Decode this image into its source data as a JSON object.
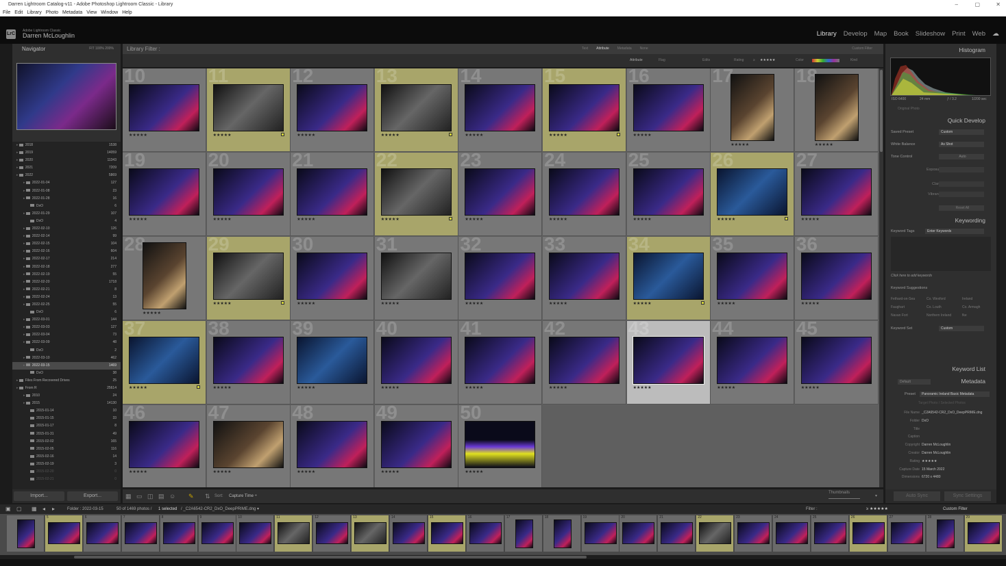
{
  "window": {
    "title": "Darren Lightroom Catalog-v11 - Adobe Photoshop Lightroom Classic - Library",
    "minimize": "–",
    "maximize": "▢",
    "close": "✕"
  },
  "menu": [
    "File",
    "Edit",
    "Library",
    "Photo",
    "Metadata",
    "View",
    "Window",
    "Help"
  ],
  "identity": {
    "badge": "LrC",
    "app": "Adobe Lightroom Classic",
    "user": "Darren McLoughlin"
  },
  "modules": [
    "Library",
    "Develop",
    "Map",
    "Book",
    "Slideshow",
    "Print",
    "Web"
  ],
  "active_module": "Library",
  "navigator": {
    "title": "Navigator",
    "zoom": "FIT   100%   200%"
  },
  "folders": [
    {
      "name": "2018",
      "count": "1538",
      "indent": 0
    },
    {
      "name": "2019",
      "count": "14059",
      "indent": 0
    },
    {
      "name": "2020",
      "count": "11343",
      "indent": 0
    },
    {
      "name": "2021",
      "count": "7209",
      "indent": 0
    },
    {
      "name": "2022",
      "count": "5869",
      "indent": 0
    },
    {
      "name": "2022-01-04",
      "count": "127",
      "indent": 1
    },
    {
      "name": "2022-01-08",
      "count": "23",
      "indent": 1
    },
    {
      "name": "2022-01-28",
      "count": "16",
      "indent": 1
    },
    {
      "name": "DxO",
      "count": "6",
      "indent": 2
    },
    {
      "name": "2022-01-29",
      "count": "107",
      "indent": 1
    },
    {
      "name": "DxO",
      "count": "4",
      "indent": 2
    },
    {
      "name": "2022-02-10",
      "count": "126",
      "indent": 1
    },
    {
      "name": "2022-02-14",
      "count": "99",
      "indent": 1
    },
    {
      "name": "2022-02-15",
      "count": "104",
      "indent": 1
    },
    {
      "name": "2022-02-16",
      "count": "604",
      "indent": 1
    },
    {
      "name": "2022-02-17",
      "count": "214",
      "indent": 1
    },
    {
      "name": "2022-02-18",
      "count": "277",
      "indent": 1
    },
    {
      "name": "2022-02-19",
      "count": "55",
      "indent": 1
    },
    {
      "name": "2022-02-20",
      "count": "1718",
      "indent": 1
    },
    {
      "name": "2022-02-21",
      "count": "8",
      "indent": 1
    },
    {
      "name": "2022-02-24",
      "count": "13",
      "indent": 1
    },
    {
      "name": "2022-02-25",
      "count": "55",
      "indent": 1
    },
    {
      "name": "DxO",
      "count": "6",
      "indent": 2
    },
    {
      "name": "2022-03-01",
      "count": "144",
      "indent": 1
    },
    {
      "name": "2022-03-03",
      "count": "127",
      "indent": 1
    },
    {
      "name": "2022-03-04",
      "count": "73",
      "indent": 1
    },
    {
      "name": "2022-03-09",
      "count": "48",
      "indent": 1
    },
    {
      "name": "DxO",
      "count": "2",
      "indent": 2
    },
    {
      "name": "2022-03-10",
      "count": "462",
      "indent": 1
    },
    {
      "name": "2022-03-15",
      "count": "1469",
      "indent": 1,
      "selected": true
    },
    {
      "name": "DxO",
      "count": "38",
      "indent": 2
    },
    {
      "name": "Files From Recovered Drives",
      "count": "25",
      "indent": 0
    },
    {
      "name": "From R",
      "count": "25614",
      "indent": 0
    },
    {
      "name": "2010",
      "count": "24",
      "indent": 1
    },
    {
      "name": "2015",
      "count": "14130",
      "indent": 1
    },
    {
      "name": "2015-01-14",
      "count": "10",
      "indent": 2
    },
    {
      "name": "2015-01-15",
      "count": "33",
      "indent": 2
    },
    {
      "name": "2015-01-17",
      "count": "8",
      "indent": 2
    },
    {
      "name": "2015-01-31",
      "count": "49",
      "indent": 2
    },
    {
      "name": "2015-02-02",
      "count": "165",
      "indent": 2
    },
    {
      "name": "2015-02-05",
      "count": "116",
      "indent": 2
    },
    {
      "name": "2015-02-16",
      "count": "14",
      "indent": 2
    },
    {
      "name": "2015-02-19",
      "count": "3",
      "indent": 2
    },
    {
      "name": "2015-02-20",
      "count": "0",
      "indent": 2,
      "dim": true
    },
    {
      "name": "2015-02-21",
      "count": "0",
      "indent": 2,
      "dim": true
    }
  ],
  "buttons": {
    "import": "Import...",
    "export": "Export..."
  },
  "library_filter": {
    "title": "Library Filter :",
    "tabs": [
      "Text",
      "Attribute",
      "Metadata",
      "None"
    ],
    "active": "Attribute",
    "custom": "Custom Filter"
  },
  "attribute_bar": {
    "attribute": "Attribute",
    "flag": "Flag",
    "edits": "Edits",
    "rating": "Rating",
    "rating_op": "≥",
    "stars": "★★★★★",
    "color": "Color",
    "kind": "Kind"
  },
  "grid_rows": [
    [
      {
        "n": "10",
        "o": "l",
        "t": ""
      },
      {
        "n": "11",
        "o": "l",
        "t": "bw",
        "pick": true
      },
      {
        "n": "12",
        "o": "l",
        "t": ""
      },
      {
        "n": "13",
        "o": "l",
        "t": "bw",
        "pick": true
      },
      {
        "n": "14",
        "o": "l",
        "t": ""
      },
      {
        "n": "15",
        "o": "l",
        "t": "",
        "pick": true
      },
      {
        "n": "16",
        "o": "l",
        "t": ""
      },
      {
        "n": "17",
        "o": "p",
        "t": "w"
      },
      {
        "n": "18",
        "o": "p",
        "t": "w"
      }
    ],
    [
      {
        "n": "19",
        "o": "l",
        "t": ""
      },
      {
        "n": "20",
        "o": "l",
        "t": ""
      },
      {
        "n": "21",
        "o": "l",
        "t": ""
      },
      {
        "n": "22",
        "o": "l",
        "t": "bw",
        "pick": true
      },
      {
        "n": "23",
        "o": "l",
        "t": ""
      },
      {
        "n": "24",
        "o": "l",
        "t": ""
      },
      {
        "n": "25",
        "o": "l",
        "t": ""
      },
      {
        "n": "26",
        "o": "l",
        "t": "bl",
        "pick": true
      },
      {
        "n": "27",
        "o": "l",
        "t": ""
      }
    ],
    [
      {
        "n": "28",
        "o": "p",
        "t": "w"
      },
      {
        "n": "29",
        "o": "l",
        "t": "bw",
        "pick": true
      },
      {
        "n": "30",
        "o": "l",
        "t": ""
      },
      {
        "n": "31",
        "o": "l",
        "t": "bw"
      },
      {
        "n": "32",
        "o": "l",
        "t": ""
      },
      {
        "n": "33",
        "o": "l",
        "t": ""
      },
      {
        "n": "34",
        "o": "l",
        "t": "bl",
        "pick": true
      },
      {
        "n": "35",
        "o": "l",
        "t": ""
      },
      {
        "n": "36",
        "o": "l",
        "t": ""
      }
    ],
    [
      {
        "n": "37",
        "o": "l",
        "t": "bl",
        "pick": true
      },
      {
        "n": "38",
        "o": "l",
        "t": ""
      },
      {
        "n": "39",
        "o": "l",
        "t": "bl"
      },
      {
        "n": "40",
        "o": "l",
        "t": ""
      },
      {
        "n": "41",
        "o": "l",
        "t": ""
      },
      {
        "n": "42",
        "o": "l",
        "t": ""
      },
      {
        "n": "43",
        "o": "l",
        "t": "",
        "cur": true
      },
      {
        "n": "44",
        "o": "l",
        "t": ""
      },
      {
        "n": "45",
        "o": "l",
        "t": ""
      }
    ],
    [
      {
        "n": "46",
        "o": "l",
        "t": ""
      },
      {
        "n": "47",
        "o": "l",
        "t": "w"
      },
      {
        "n": "48",
        "o": "l",
        "t": ""
      },
      {
        "n": "49",
        "o": "l",
        "t": ""
      },
      {
        "n": "50",
        "o": "l",
        "t": "g"
      }
    ]
  ],
  "stars": "★★★★★",
  "toolbar": {
    "sort_label": "Sort:",
    "sort_value": "Capture Time ÷",
    "thumbnails": "Thumbnails"
  },
  "histogram": {
    "title": "Histogram",
    "iso": "ISO 6400",
    "focal": "24 mm",
    "aperture": "ƒ / 3.2",
    "shutter": "1/200 sec",
    "original": "Original Photo"
  },
  "quick_develop": {
    "title": "Quick Develop",
    "saved_preset_label": "Saved Preset",
    "saved_preset": "Custom",
    "wb_label": "White Balance",
    "wb": "As Shot",
    "tone_label": "Tone Control",
    "auto": "Auto",
    "exposure": "Exposure",
    "clarity": "Clarity",
    "vibrance": "Vibrance",
    "reset": "Reset All"
  },
  "keywording": {
    "title": "Keywording",
    "tags_label": "Keyword Tags",
    "tags_value": "Enter Keywords",
    "hint": "Click here to add keywords",
    "suggestions_label": "Keyword Suggestions",
    "suggestions": [
      "Fethard-on-Sea",
      "Co. Wexford",
      "Ireland",
      "Faughart",
      "Co. Louth",
      "Co. Armagh",
      "Navan Fort",
      "Northern Ireland",
      "fke"
    ],
    "set_label": "Keyword Set",
    "set_value": "Custom"
  },
  "keyword_list": {
    "title": "Keyword List"
  },
  "metadata": {
    "title": "Metadata",
    "default": "Default",
    "preset_label": "Preset",
    "preset": "Panoramic Ireland Basic Metadata",
    "target": "Target Photo / Selected Photos",
    "fields": [
      {
        "label": "File Name",
        "value": "_C2A6542-CR2_DxO_DeepPRIME.dng"
      },
      {
        "label": "Folder",
        "value": "DxO"
      },
      {
        "label": "Title",
        "value": ""
      },
      {
        "label": "Caption",
        "value": ""
      },
      {
        "label": "Copyright",
        "value": "Darren McLoughlin"
      },
      {
        "label": "Creator",
        "value": "Darren McLoughlin"
      },
      {
        "label": "Rating",
        "value": "★★★★★"
      },
      {
        "label": "Capture Date",
        "value": "15 March 2022"
      },
      {
        "label": "Dimensions",
        "value": "6720 x 4480"
      }
    ]
  },
  "sync": {
    "auto": "Auto Sync",
    "settings": "Sync Settings"
  },
  "filmstrip_bar": {
    "folder": "Folder : 2022-03-15",
    "count": "50 of 1469 photos /",
    "selected": "1 selected",
    "file": "/ _C2A6542-CR2_DxO_DeepPRIME.dng ▾",
    "filter_label": "Filter :",
    "filter_stars": "≥ ★★★★★",
    "filter_value": "Custom Filter"
  },
  "filmstrip": [
    {
      "n": "",
      "p": true,
      "pick": false
    },
    {
      "n": "5",
      "p": false,
      "pick": true
    },
    {
      "n": "6",
      "p": false,
      "pick": false
    },
    {
      "n": "7",
      "p": false,
      "pick": false
    },
    {
      "n": "8",
      "p": false,
      "pick": false
    },
    {
      "n": "9",
      "p": false,
      "pick": false
    },
    {
      "n": "10",
      "p": false,
      "pick": false
    },
    {
      "n": "11",
      "p": false,
      "pick": true,
      "bw": true
    },
    {
      "n": "12",
      "p": false,
      "pick": false
    },
    {
      "n": "13",
      "p": false,
      "pick": true,
      "bw": true
    },
    {
      "n": "14",
      "p": false,
      "pick": false
    },
    {
      "n": "15",
      "p": false,
      "pick": true
    },
    {
      "n": "16",
      "p": false,
      "pick": false
    },
    {
      "n": "17",
      "p": true,
      "pick": false
    },
    {
      "n": "18",
      "p": true,
      "pick": false
    },
    {
      "n": "19",
      "p": false,
      "pick": false
    },
    {
      "n": "20",
      "p": false,
      "pick": false
    },
    {
      "n": "21",
      "p": false,
      "pick": false
    },
    {
      "n": "22",
      "p": false,
      "pick": true,
      "bw": true
    },
    {
      "n": "23",
      "p": false,
      "pick": false
    },
    {
      "n": "24",
      "p": false,
      "pick": false
    },
    {
      "n": "25",
      "p": false,
      "pick": false
    },
    {
      "n": "26",
      "p": false,
      "pick": true
    },
    {
      "n": "27",
      "p": false,
      "pick": false
    },
    {
      "n": "28",
      "p": true,
      "pick": false
    },
    {
      "n": "29",
      "p": false,
      "pick": true
    }
  ]
}
